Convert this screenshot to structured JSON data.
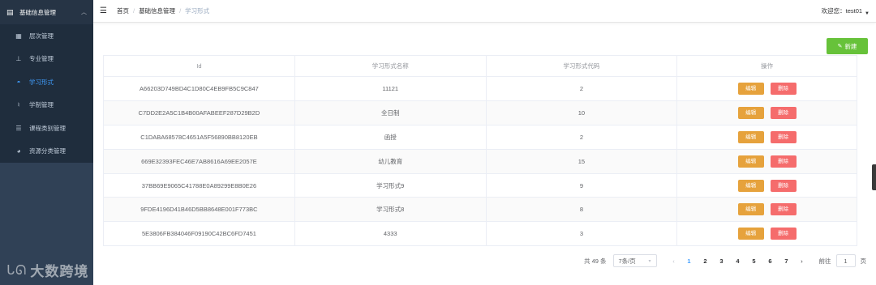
{
  "sidebar": {
    "group_label": "基础信息管理",
    "items": [
      {
        "label": "层次管理",
        "icon": "grid-icon"
      },
      {
        "label": "专业管理",
        "icon": "tree-icon"
      },
      {
        "label": "学习形式",
        "icon": "dashboard-icon"
      },
      {
        "label": "学制管理",
        "icon": "book-icon"
      },
      {
        "label": "课程类别管理",
        "icon": "list-icon"
      },
      {
        "label": "资源分类管理",
        "icon": "globe-icon"
      }
    ],
    "active_index": 2,
    "watermark": "大数跨境"
  },
  "breadcrumb": {
    "home": "首页",
    "parent": "基础信息管理",
    "current": "学习形式"
  },
  "user": {
    "welcome": "欢迎您：test01"
  },
  "toolbar": {
    "new_label": "新建"
  },
  "table": {
    "headers": [
      "Id",
      "学习形式名称",
      "学习形式代码",
      "操作"
    ],
    "edit_label": "编辑",
    "delete_label": "删除",
    "rows": [
      {
        "id": "A66203D749BD4C1D80C4EB9FB5C9C847",
        "name": "11121",
        "code": "2"
      },
      {
        "id": "C7DD2E2A5C1B4B00AFABEEF287D29B2D",
        "name": "全日制",
        "code": "10"
      },
      {
        "id": "C1DABA68578C4651A5F56890BB8120EB",
        "name": "函授",
        "code": "2"
      },
      {
        "id": "669E32393FEC46E7AB8616A69EE2057E",
        "name": "幼儿教育",
        "code": "15"
      },
      {
        "id": "37BB69E9065C41788E0A89299E8B0E26",
        "name": "学习形式9",
        "code": "9"
      },
      {
        "id": "9FDE4196D41B46D5BB8648E001F773BC",
        "name": "学习形式8",
        "code": "8"
      },
      {
        "id": "5E3806FB384046F09190C42BC6FD7451",
        "name": "4333",
        "code": "3"
      }
    ]
  },
  "pagination": {
    "total": "共 49 条",
    "page_size": "7条/页",
    "pages": [
      "1",
      "2",
      "3",
      "4",
      "5",
      "6",
      "7"
    ],
    "current": "1",
    "goto_label": "前往",
    "goto_value": "1",
    "page_unit": "页"
  }
}
